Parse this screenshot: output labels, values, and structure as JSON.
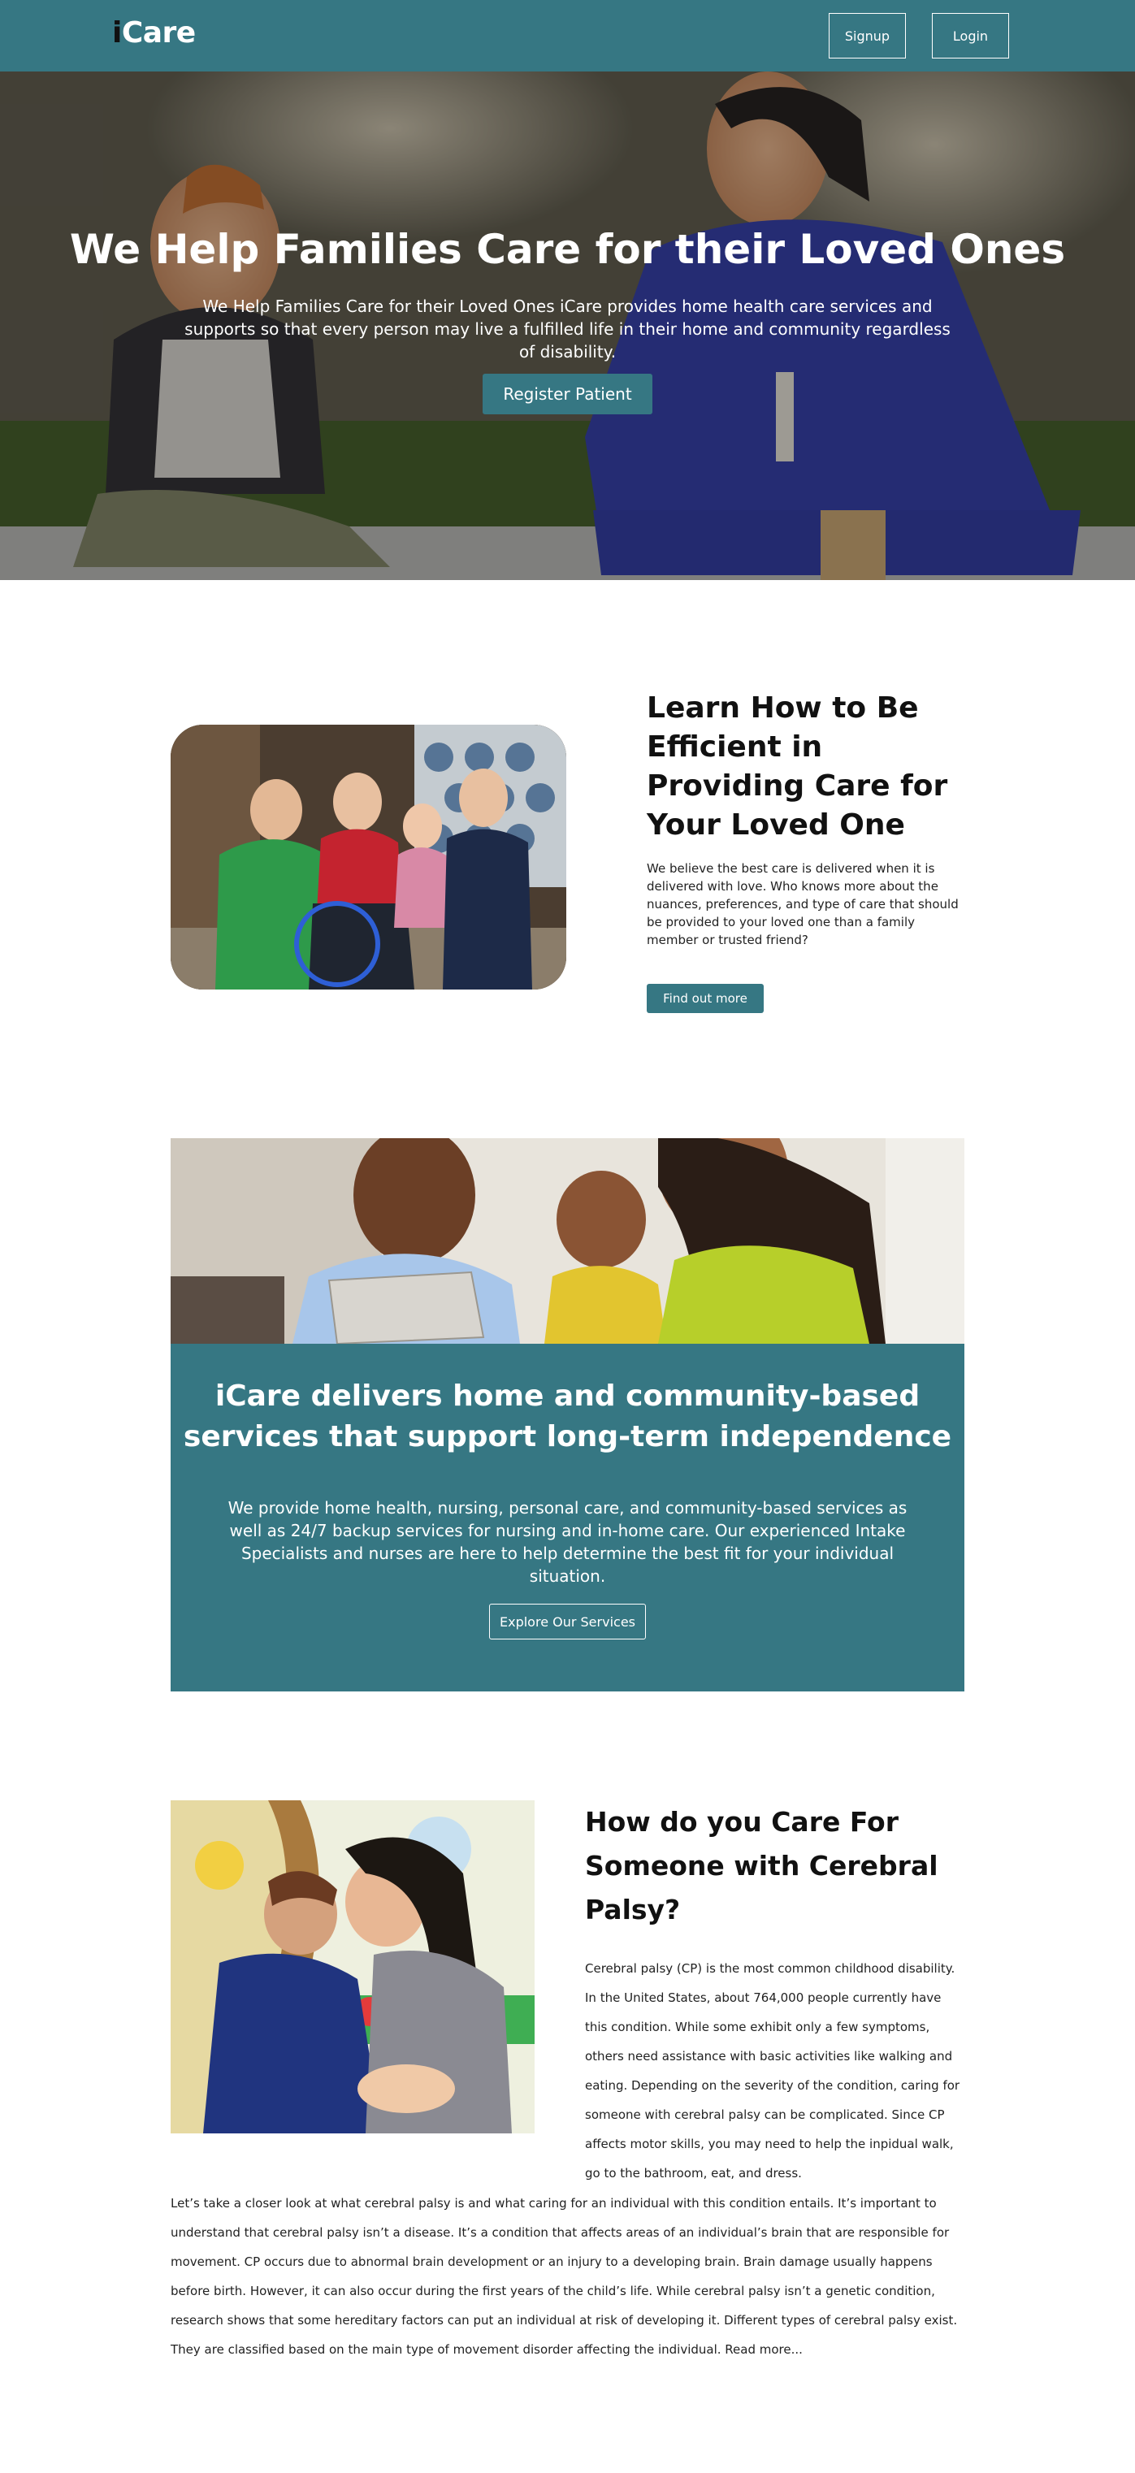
{
  "navbar": {
    "logo_i": "i",
    "logo_rest": "Care",
    "signup_label": "Signup",
    "login_label": "Login",
    "color": "#367783"
  },
  "hero": {
    "title": "We Help Families Care for their Loved Ones",
    "subtitle": "We Help Families Care for their Loved Ones iCare provides home health care services and supports so that every person may live a fulfilled life in their home and community regardless of disability.",
    "button_label": "Register Patient"
  },
  "learn": {
    "title": "Learn How to Be Efficient in Providing Care for Your Loved One",
    "text": "We believe the best care is delivered when it is delivered with love. Who knows more about the nuances, preferences, and type of care that should be provided to your loved one than a family member or trusted friend?",
    "button_label": "Find out more"
  },
  "services": {
    "title": "iCare delivers home and community-based services that support long-term independence",
    "text": "We provide home health, nursing, personal care, and community-based services as well as 24/7 backup services for nursing and in-home care. Our experienced Intake Specialists and nurses are here to help determine the best fit for your individual situation.",
    "button_label": "Explore Our Services"
  },
  "cerebral": {
    "title": "How do you Care For Someone with Cerebral Palsy?",
    "text_side": "Cerebral palsy (CP) is the most common childhood disability. In the United States, about 764,000 people currently have this condition. While some exhibit only a few symptoms, others need assistance with basic activities like walking and eating. Depending on the severity of the condition, caring for someone with cerebral palsy can be complicated. Since CP affects motor skills, you may need to help the inpidual walk, go to the bathroom, eat, and dress.",
    "text_full": "Let’s take a closer look at what cerebral palsy is and what caring for an individual with this condition entails. It’s important to understand that cerebral palsy isn’t a disease. It’s a condition that affects areas of an individual’s brain that are responsible for movement. CP occurs due to abnormal brain development or an injury to a developing brain. Brain damage usually happens before birth. However, it can also occur during the first years of the child’s life. While cerebral palsy isn’t a genetic condition, research shows that some hereditary factors can put an individual at risk of developing it. Different types of cerebral palsy exist. They are classified based on the main type of movement disorder affecting the individual. Read more..."
  }
}
